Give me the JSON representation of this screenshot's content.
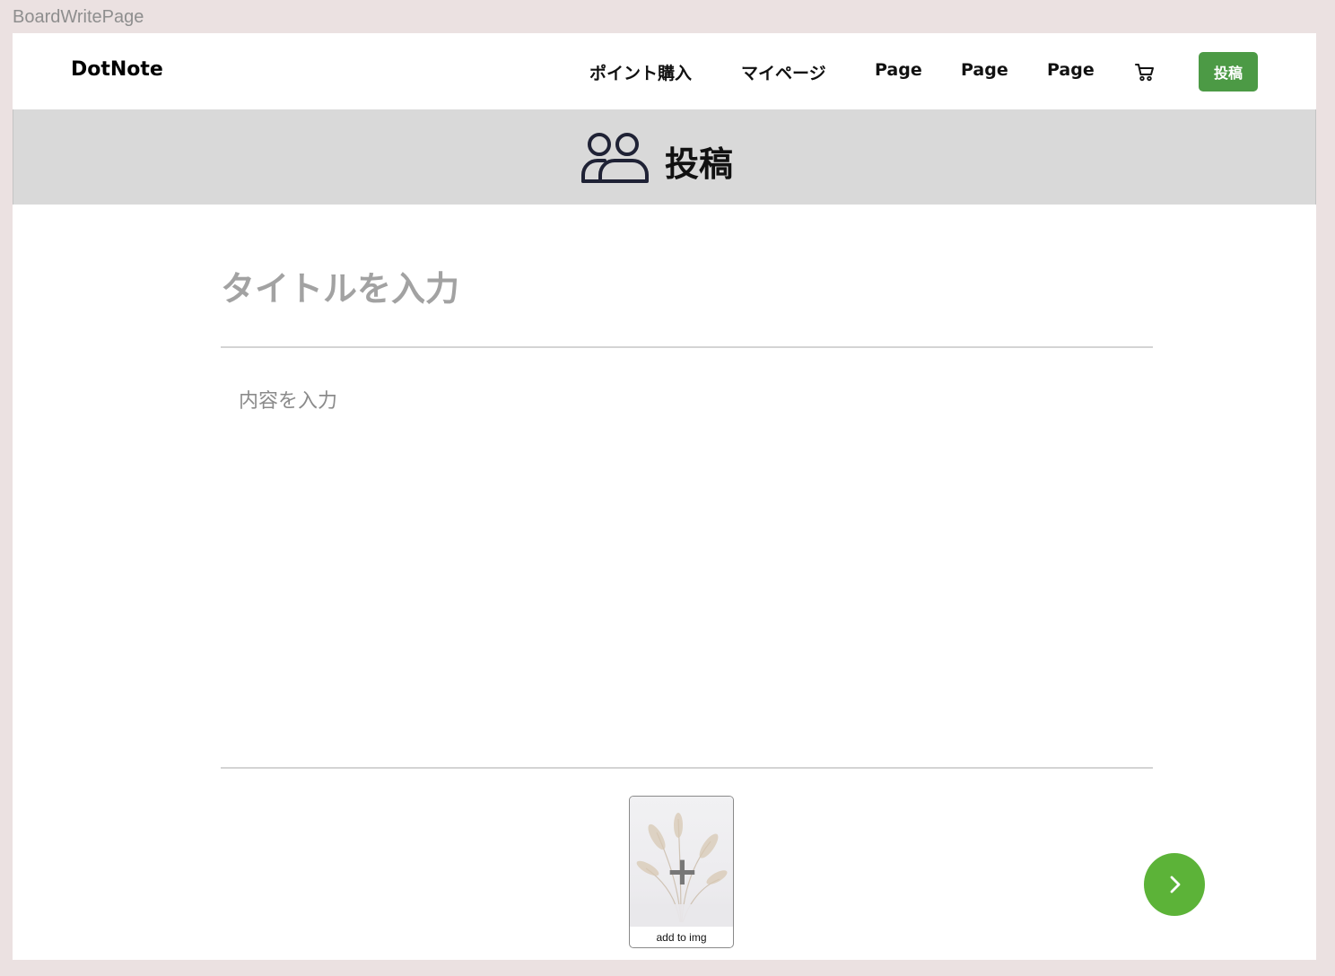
{
  "frame": {
    "label": "BoardWritePage"
  },
  "header": {
    "logo": "DotNote",
    "nav": [
      "ポイント購入",
      "マイページ",
      "Page",
      "Page",
      "Page"
    ],
    "cart_icon": "cart-icon",
    "post_button": "投稿"
  },
  "banner": {
    "icon": "users-icon",
    "title": "投稿"
  },
  "form": {
    "title_placeholder": "タイトルを入力",
    "title_value": "",
    "content_placeholder": "内容を入力",
    "content_value": ""
  },
  "image_upload": {
    "label": "add to img",
    "plus_icon": "plus-icon"
  },
  "next_button": {
    "icon": "chevron-right-icon"
  },
  "colors": {
    "accent_green": "#4c9a45",
    "next_green": "#5cb338",
    "banner_gray": "#d9d9d9",
    "canvas": "#ebe1e1"
  }
}
